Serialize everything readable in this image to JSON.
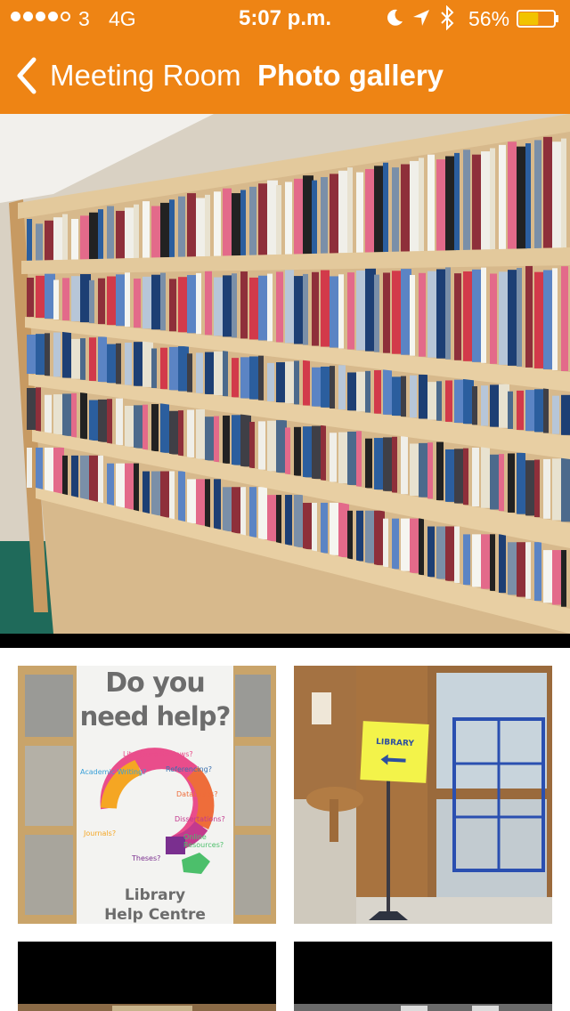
{
  "status_bar": {
    "carrier": "3",
    "network": "4G",
    "time": "5:07 p.m.",
    "battery_percent": "56%",
    "battery_level": 0.56,
    "signal_bars_filled": 4,
    "signal_bars_total": 5,
    "icons": [
      "moon-icon",
      "location-arrow-icon",
      "bluetooth-icon",
      "battery-icon"
    ]
  },
  "nav": {
    "back_label": "Meeting Room",
    "title": "Photo gallery"
  },
  "gallery": {
    "hero_photo": "library-bookshelves",
    "thumbnails": [
      {
        "name": "library-help-centre-banner",
        "banner_heading_1": "Do you",
        "banner_heading_2": "need help?",
        "banner_items": [
          "Literature Reviews?",
          "Academic Writing?",
          "Referencing?",
          "Databases?",
          "Dissertations?",
          "Journals?",
          "Online Resources?",
          "Theses?"
        ],
        "banner_footer_1": "Library",
        "banner_footer_2": "Help Centre"
      },
      {
        "name": "library-sign-doorway",
        "sign_text": "LIBRARY"
      },
      {
        "name": "thumbnail-3"
      },
      {
        "name": "thumbnail-4"
      }
    ]
  },
  "colors": {
    "accent": "#EE8414",
    "battery_fill": "#F2C300"
  }
}
